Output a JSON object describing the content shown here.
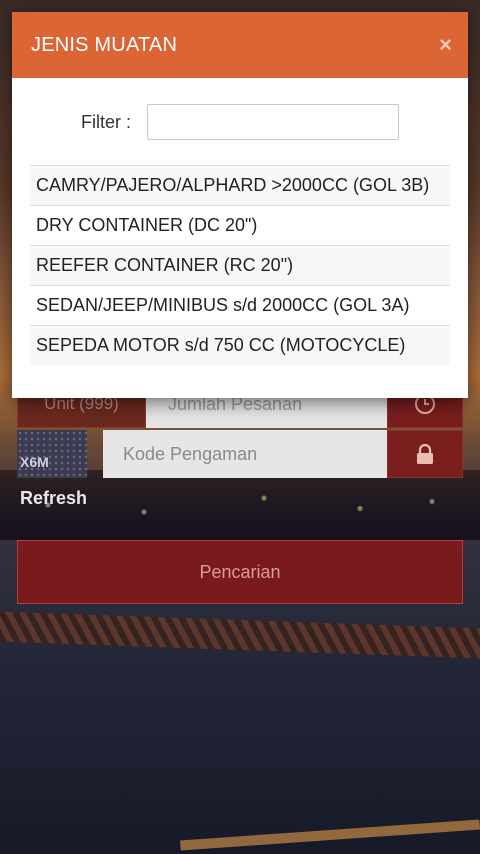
{
  "form": {
    "unit_label": "Unit (999)",
    "qty_placeholder": "Jumlah Pesanan",
    "captcha_text": "X6M",
    "code_placeholder": "Kode Pengaman",
    "refresh_label": "Refresh",
    "search_label": "Pencarian"
  },
  "modal": {
    "title": "JENIS MUATAN",
    "close_glyph": "×",
    "filter_label": "Filter :",
    "filter_value": "",
    "items": [
      {
        "label": "CAMRY/PAJERO/ALPHARD >2000CC (GOL 3B)"
      },
      {
        "label": "DRY CONTAINER (DC 20\")"
      },
      {
        "label": "REEFER CONTAINER (RC 20\")"
      },
      {
        "label": "SEDAN/JEEP/MINIBUS s/d 2000CC (GOL 3A)"
      },
      {
        "label": "SEPEDA MOTOR s/d 750 CC (MOTOCYCLE)"
      }
    ]
  },
  "colors": {
    "header": "#dc6535",
    "button": "#7a1a1c"
  }
}
